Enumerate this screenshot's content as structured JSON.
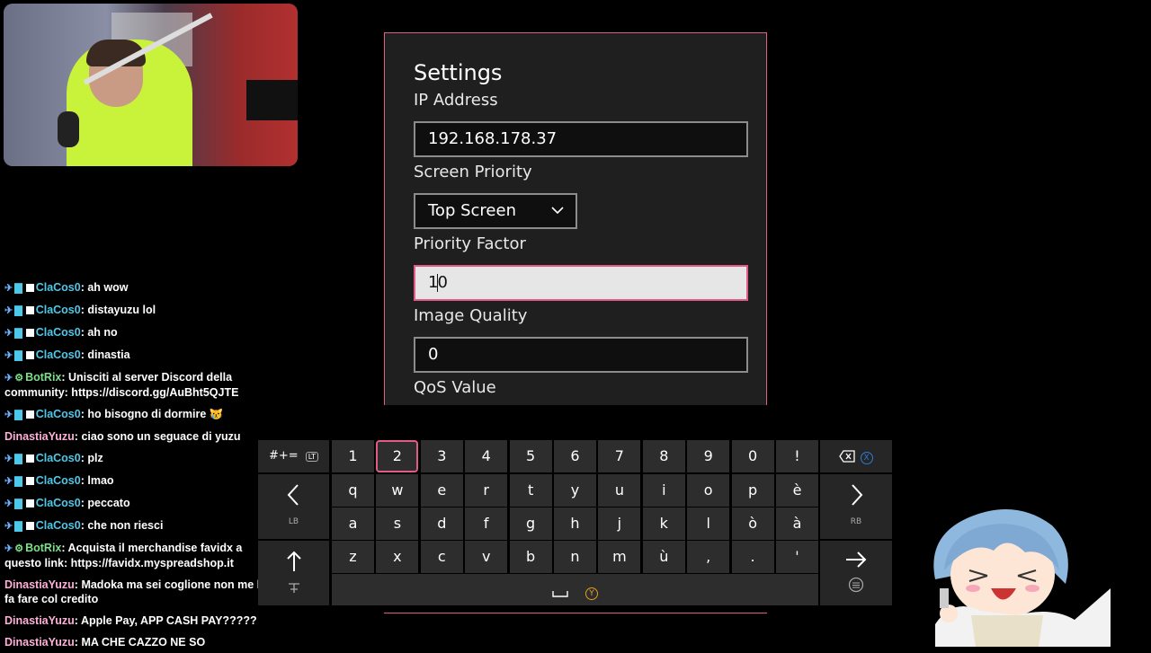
{
  "settings": {
    "title": "Settings",
    "ip_label": "IP Address",
    "ip_value": "192.168.178.37",
    "screen_priority_label": "Screen Priority",
    "screen_priority_value": "Top Screen",
    "priority_factor_label": "Priority Factor",
    "priority_factor_before_caret": "1",
    "priority_factor_after_caret": "0",
    "image_quality_label": "Image Quality",
    "image_quality_value": "0",
    "qos_label": "QoS Value"
  },
  "keyboard": {
    "row1": [
      "1",
      "2",
      "3",
      "4",
      "5",
      "6",
      "7",
      "8",
      "9",
      "0",
      "!"
    ],
    "row2": [
      "q",
      "w",
      "e",
      "r",
      "t",
      "y",
      "u",
      "i",
      "o",
      "p",
      "è"
    ],
    "row3": [
      "a",
      "s",
      "d",
      "f",
      "g",
      "h",
      "j",
      "k",
      "l",
      "ò",
      "à"
    ],
    "row4": [
      "z",
      "x",
      "c",
      "v",
      "b",
      "n",
      "m",
      "ù",
      ",",
      ".",
      "'"
    ],
    "symbols_label": "#+=",
    "symbols_hint": "LT",
    "left_hint": "LB",
    "right_hint": "RB",
    "space_hint": "Y",
    "backspace_hint": "X",
    "selected_key": "2",
    "colors": {
      "key_bg": "#2d2d2d",
      "accent": "#e25a8a"
    }
  },
  "chat": [
    {
      "badges": "sword+sub",
      "user": "ClaCos0",
      "text": "ah wow",
      "kind": "clacos"
    },
    {
      "badges": "sword+sub",
      "user": "ClaCos0",
      "text": "distayuzu lol",
      "kind": "clacos"
    },
    {
      "badges": "sword+sub",
      "user": "ClaCos0",
      "text": "ah no",
      "kind": "clacos"
    },
    {
      "badges": "sword+sub",
      "user": "ClaCos0",
      "text": "dinastia",
      "kind": "clacos"
    },
    {
      "badges": "sword+bot",
      "user": "BotRix",
      "text": "Unisciti al server Discord della community: https://discord.gg/AuBht5QJTE",
      "kind": "botrix"
    },
    {
      "badges": "sword+sub",
      "user": "ClaCos0",
      "text": "ho bisogno di dormire 😿",
      "kind": "clacos"
    },
    {
      "badges": "",
      "user": "DinastiaYuzu",
      "text": "ciao sono un seguace di yuzu",
      "kind": "dinastia"
    },
    {
      "badges": "sword+sub",
      "user": "ClaCos0",
      "text": "plz",
      "kind": "clacos"
    },
    {
      "badges": "sword+sub",
      "user": "ClaCos0",
      "text": "lmao",
      "kind": "clacos"
    },
    {
      "badges": "sword+sub",
      "user": "ClaCos0",
      "text": "peccato",
      "kind": "clacos"
    },
    {
      "badges": "sword+sub",
      "user": "ClaCos0",
      "text": "che non riesci",
      "kind": "clacos"
    },
    {
      "badges": "sword+bot",
      "user": "BotRix",
      "text": "Acquista il merchandise favidx a questo link: https://favidx.myspreadshop.it",
      "kind": "botrix"
    },
    {
      "badges": "",
      "user": "DinastiaYuzu",
      "text": "Madoka ma sei coglione non me lo fa fare col credito",
      "kind": "dinastia"
    },
    {
      "badges": "",
      "user": "DinastiaYuzu",
      "text": "Apple Pay, APP CASH PAY?????",
      "kind": "dinastia"
    },
    {
      "badges": "",
      "user": "DinastiaYuzu",
      "text": "MA CHE CAZZO NE SO",
      "kind": "dinastia"
    }
  ]
}
